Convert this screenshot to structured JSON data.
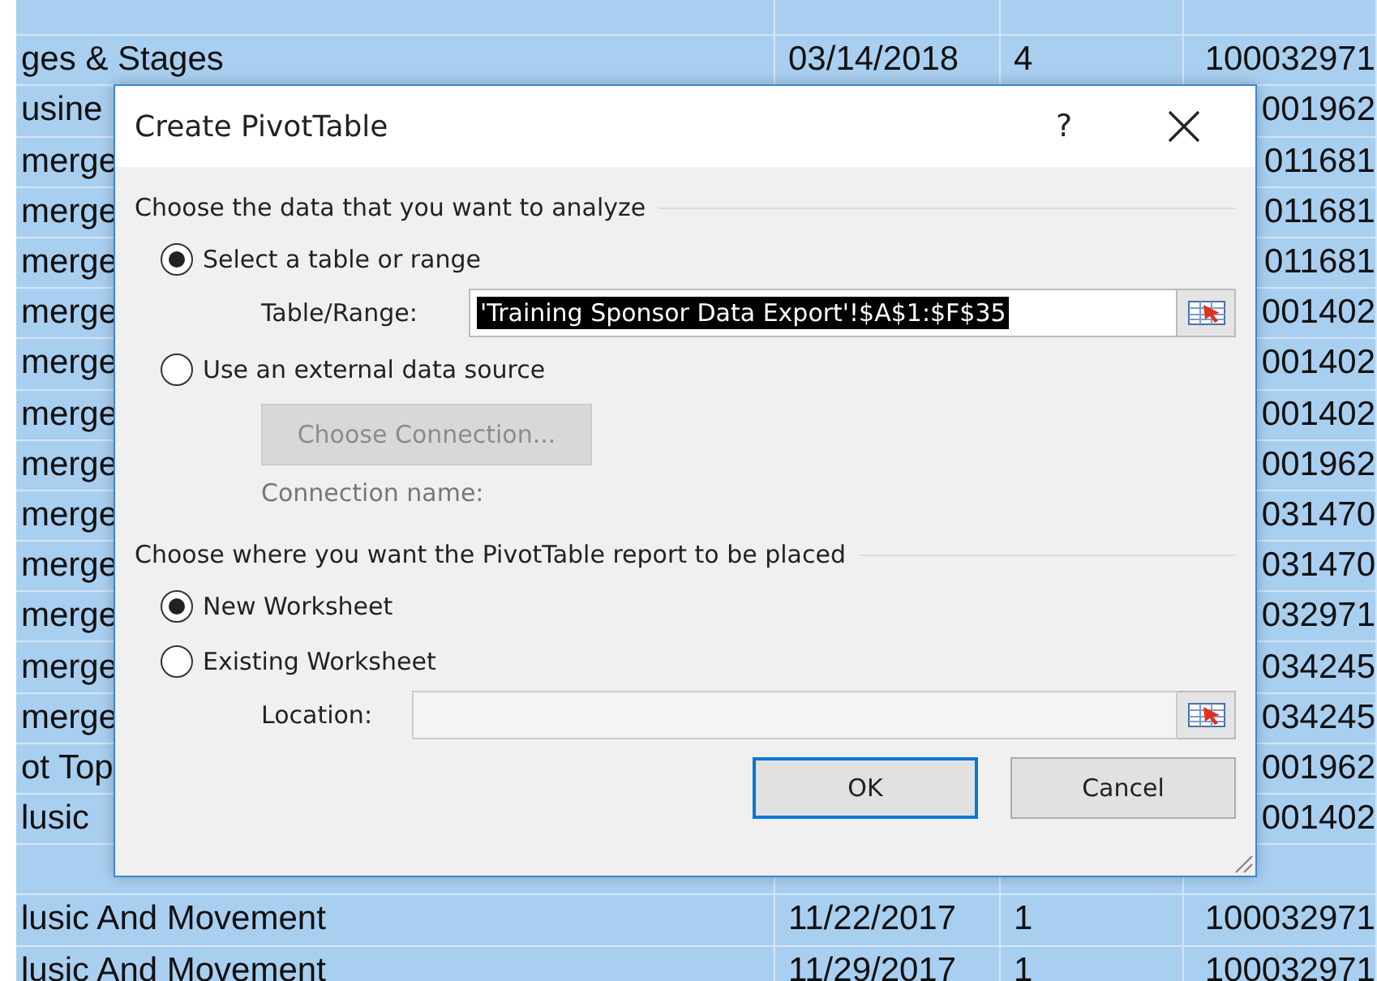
{
  "sheet": {
    "rows": [
      {
        "name": "ges & Stages",
        "end_date": "03/14/2018",
        "tour_value": "4",
        "id": "100032971"
      },
      {
        "name": "usine",
        "id": "001962"
      },
      {
        "name": "merge",
        "id": "011681"
      },
      {
        "name": "merge",
        "id": "011681"
      },
      {
        "name": "merge",
        "id": "011681"
      },
      {
        "name": "merge",
        "id": "001402"
      },
      {
        "name": "merge",
        "id": "001402"
      },
      {
        "name": "merge",
        "id": "001402"
      },
      {
        "name": "merge",
        "id": "001962"
      },
      {
        "name": "merge",
        "id": "031470"
      },
      {
        "name": "merge",
        "id": "031470"
      },
      {
        "name": "merge",
        "id": "032971"
      },
      {
        "name": "merge",
        "id": "034245"
      },
      {
        "name": "merge",
        "id": "034245"
      },
      {
        "name": "ot Top",
        "id": "001962"
      },
      {
        "name": "lusic",
        "id": "001402"
      },
      {},
      {
        "name": "lusic And Movement",
        "end_date": "11/22/2017",
        "tour_value": "1",
        "id": "100032971"
      },
      {
        "name": "lusic And Movement",
        "end_date": "11/29/2017",
        "tour_value": "1",
        "id": "100032971"
      }
    ]
  },
  "dialog": {
    "title": "Create PivotTable",
    "help": "?",
    "data_section": {
      "heading": "Choose the data that you want to analyze",
      "options": [
        {
          "label": "Select a table or range",
          "selected": true
        },
        {
          "label": "Use an external data source",
          "selected": false
        }
      ],
      "table_range": {
        "label": "Table/Range:",
        "value": "'Training Sponsor Data Export'!$A$1:$F$35",
        "text_selected": true
      },
      "choose_connection": {
        "label": "Choose Connection...",
        "disabled": true
      },
      "connection_name": {
        "label": "Connection name:",
        "disabled": true
      }
    },
    "place_section": {
      "heading": "Choose where you want the PivotTable report to be placed",
      "options": [
        {
          "label": "New Worksheet",
          "selected": true
        },
        {
          "label": "Existing Worksheet",
          "selected": false
        }
      ],
      "location": {
        "label": "Location:",
        "disabled": true
      }
    },
    "buttons": [
      {
        "label": "OK",
        "default": true
      },
      {
        "label": "Cancel",
        "default": false
      }
    ]
  }
}
